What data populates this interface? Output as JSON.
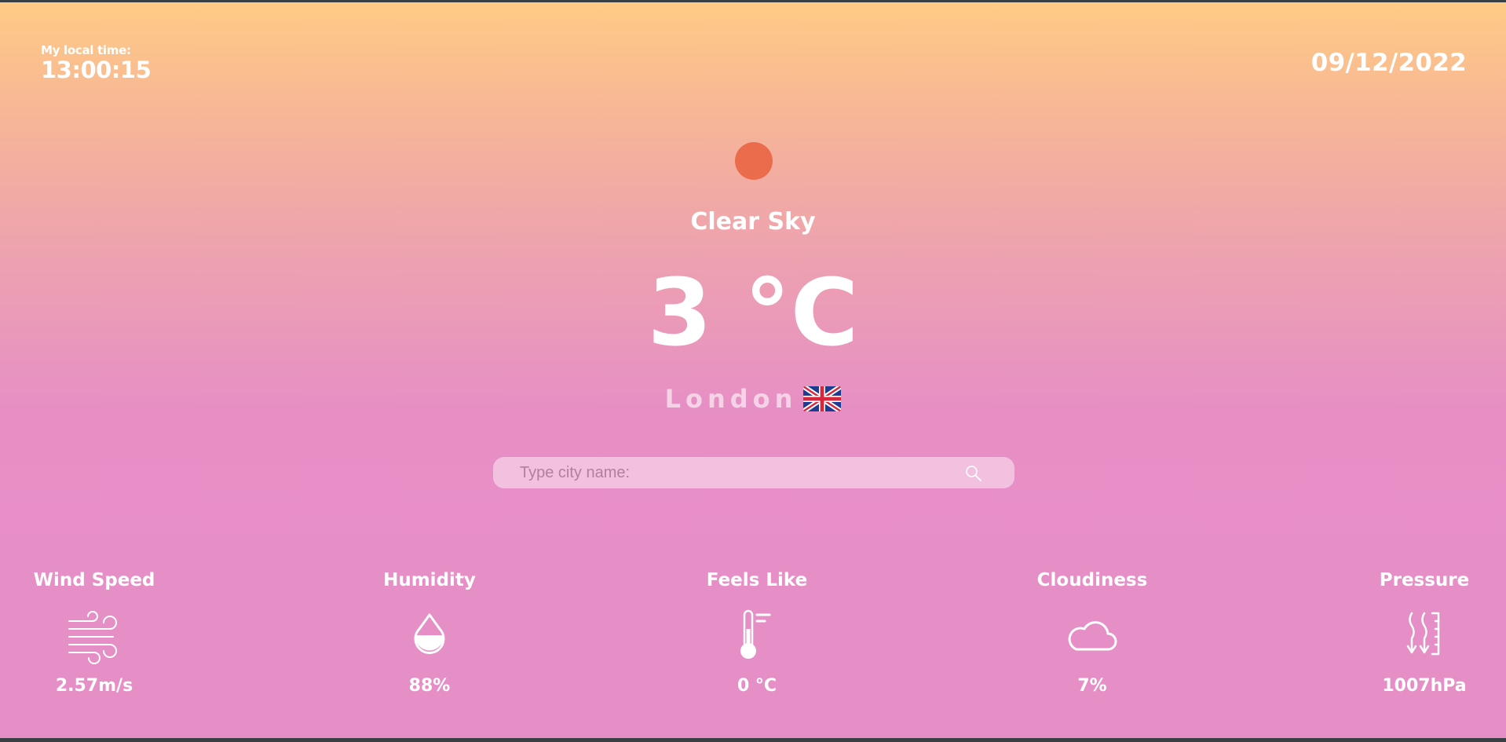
{
  "local_time": {
    "label": "My local time:",
    "value": "13:00:15"
  },
  "date": "09/12/2022",
  "weather": {
    "icon": "sun-icon",
    "condition": "Clear Sky",
    "temperature": "3 °C",
    "city": "London",
    "flag": "uk-flag-icon"
  },
  "search": {
    "placeholder": "Type city name:",
    "value": ""
  },
  "stats": [
    {
      "title": "Wind Speed",
      "value": "2.57m/s",
      "icon": "wind-icon"
    },
    {
      "title": "Humidity",
      "value": "88%",
      "icon": "humidity-drop-icon"
    },
    {
      "title": "Feels Like",
      "value": "0 °C",
      "icon": "thermometer-icon"
    },
    {
      "title": "Cloudiness",
      "value": "7%",
      "icon": "cloud-icon"
    },
    {
      "title": "Pressure",
      "value": "1007hPa",
      "icon": "pressure-icon"
    }
  ],
  "colors": {
    "sun": "#ea6c4c",
    "gradient_top": "#ffcb85",
    "gradient_bottom": "#e68fc7",
    "text": "#ffffff"
  }
}
